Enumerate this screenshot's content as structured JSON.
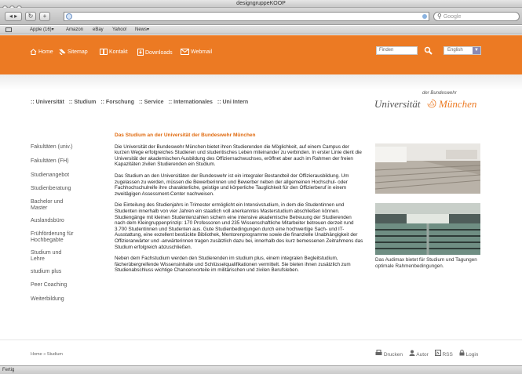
{
  "window": {
    "title": "designgruppeKOOP"
  },
  "browser": {
    "search_placeholder": "Google",
    "bookmarks": [
      "Apple (16)▾",
      "Amazon",
      "eBay",
      "Yahoo!",
      "News▾"
    ],
    "status": "Fertig"
  },
  "nav": {
    "home": "Home",
    "sitemap": "Sitemap",
    "kontakt": "Kontakt",
    "downloads": "Downloads",
    "webmail": "Webmail",
    "find_placeholder": "Finden",
    "language": "English"
  },
  "main_menu": [
    ":: Universität",
    ":: Studium",
    ":: Forschung",
    ":: Service",
    ":: Internationales",
    ":: Uni Intern"
  ],
  "logo": {
    "small": "der Bundeswehr",
    "uni": "Universität",
    "city": "München"
  },
  "sidebar": [
    "Fakultäten (univ.)",
    "Fakultäten (FH)",
    "Studienangebot",
    "Studienberatung",
    "Bachelor und Master",
    "Auslandsbüro",
    "Frühförderung für Hochbegabte",
    "Studium und Lehre",
    "studium plus",
    "Peer Coaching",
    "Weiterbildung"
  ],
  "content": {
    "heading": "Das Studium an der Universität der Bundeswehr München",
    "p1": "Die Universität der Bundeswehr München bietet ihren Studierenden die Möglichkeit, auf einem Campus der kurzen Wege erfolgreiches Studieren und studentisches Leben miteinander zu verbinden. In erster Linie dient die Universität der akademischen Ausbildung des Offiziernachwuchses, eröffnet aber auch im Rahmen der freien Kapazitäten zivilen Studierenden ein Studium.",
    "p2": "Das Studium an den Universitäten der Bundeswehr ist ein integraler Bestandteil der Offizierausbildung. Um zugelassen zu werden, müssen die Bewerberinnen und Bewerber neben der allgemeinen Hochschul- oder Fachhochschulreife ihre charakterliche, geistige und körperliche Tauglichkeit für den Offizierberuf in einem zweitägigen Assessment-Center nachweisen.",
    "p3": "Die Einteilung des Studienjahrs in Trimester ermöglicht ein Intensivstudium, in dem die Studentinnen und Studenten innerhalb von vier Jahren ein staatlich voll anerkanntes Masterstudium abschließen können. Studiengänge mit kleinen Studentenzahlen sichern eine intensive akademische Betreuung der Studierenden nach dem Kleingruppenprinzip: 170 Professoren und 235 Wissenschaftliche Mitarbeiter betreuen derzeit rund 3.700 Studentinnen und Studenten aus. Gute Studienbedingungen durch eine hochwertige Sach- und IT-Ausstattung, eine exzellent bestückte Bibliothek, Mentorenprogramme sowie die finanzielle Unabhängigkeit der Offizieranwärter und -anwärterinnen tragen zusätzlich dazu bei, innerhalb des kurz bemessenen Zeitrahmens das Studium erfolgreich abzuschließen.",
    "p4": "Neben dem Fachstudium werden den Studierenden im studium plus, einem integralen Begleitstudium, fächerübergreifende Wissensinhalte und Schlüsselqualifikationen vermittelt. Sie bieten ihnen zusätzlich zum Studienabschluss wichtige Chancenvorteile im militärischen und zivilen Berufsleben."
  },
  "caption": "Das Audimax bietet für Studium und Tagungen optimale Rahmenbedingungen.",
  "breadcrumb": "Home » Studium",
  "tools": {
    "print": "Drucken",
    "author": "Autor",
    "rss": "RSS",
    "login": "Login"
  },
  "colors": {
    "accent": "#ec7a23",
    "heading": "#e06b10"
  }
}
